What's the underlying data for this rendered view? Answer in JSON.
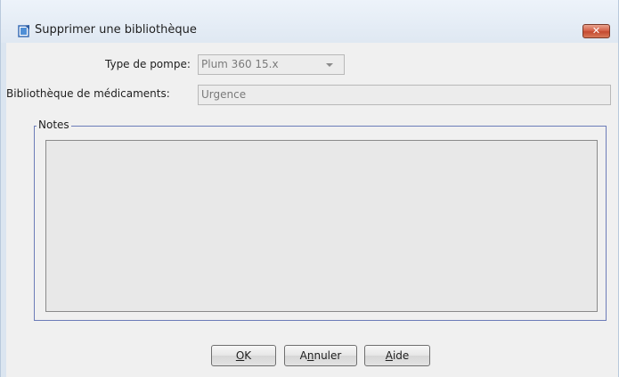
{
  "window": {
    "title": "Supprimer une bibliothèque",
    "close_label": "✕"
  },
  "form": {
    "pump_type_label": "Type de pompe:",
    "pump_type_value": "Plum 360 15.x",
    "library_label": "Bibliothèque de médicaments:",
    "library_value": "Urgence"
  },
  "notes": {
    "legend": "Notes",
    "text": ""
  },
  "buttons": {
    "ok_pre": "",
    "ok_mnemonic": "O",
    "ok_post": "K",
    "cancel_pre": "A",
    "cancel_mnemonic": "n",
    "cancel_post": "nuler",
    "help_pre": "",
    "help_mnemonic": "A",
    "help_post": "ide"
  },
  "colors": {
    "accent": "#6c7cb8",
    "close_button": "#d5644b",
    "disabled_text": "#7a7a7a"
  },
  "icons": {
    "app": "document-check-icon",
    "close": "close-icon",
    "dropdown": "chevron-down-icon"
  }
}
